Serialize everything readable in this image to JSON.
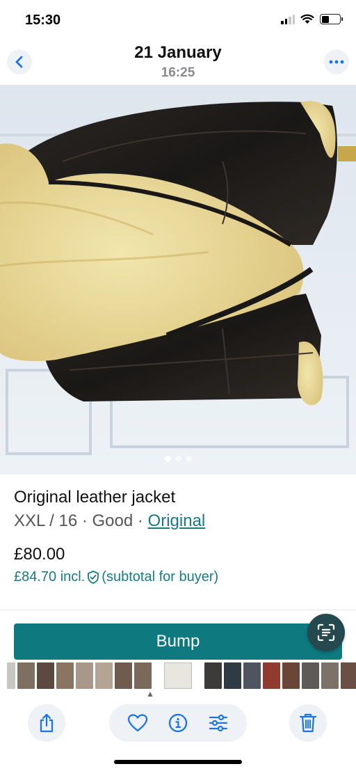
{
  "status_bar": {
    "time": "15:30",
    "battery_level": 0.4,
    "signal_bars": 2
  },
  "header": {
    "date": "21 January",
    "time": "16:25",
    "back_icon": "chevron-left-icon",
    "more_icon": "ellipsis-icon"
  },
  "photo": {
    "page_count": 3,
    "active_page": 1
  },
  "listing": {
    "title": "Original leather jacket",
    "size": "XXL / 16",
    "separator": " · ",
    "condition": "Good",
    "brand": "Original",
    "price": "£80.00",
    "price_incl": "£84.70 incl.",
    "subtotal_note": "(subtotal for buyer)"
  },
  "bump": {
    "label": "Bump"
  },
  "toolbar": {
    "icons": [
      "share-icon",
      "heart-icon",
      "info-icon",
      "adjust-icon",
      "trash-icon"
    ]
  },
  "colors": {
    "accent": "#0e7a80",
    "link": "#167b83",
    "toolbar_bg": "#eef1f5",
    "ios_blue": "#1a73e8"
  }
}
